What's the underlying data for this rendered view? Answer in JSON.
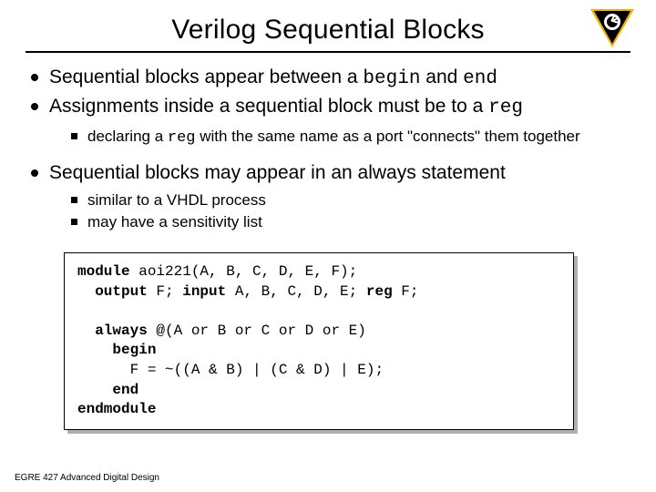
{
  "title": "Verilog Sequential Blocks",
  "footer": "EGRE 427 Advanced Digital Design",
  "bullets": {
    "b1_a": "Sequential blocks appear between a ",
    "b1_code1": "begin",
    "b1_b": " and ",
    "b1_code2": "end",
    "b2_a": "Assignments inside a sequential block must be to a ",
    "b2_code1": "reg",
    "b2s1_a": "declaring a ",
    "b2s1_code1": "reg",
    "b2s1_b": " with the same name as a port \"connects\" them together",
    "b3": "Sequential blocks may appear in an always statement",
    "b3s1": "similar to a VHDL process",
    "b3s2": "may have a sensitivity list"
  },
  "code": {
    "kw_module": "module",
    "mod_decl": " aoi221(A, B, C, D, E, F);",
    "kw_output": "output",
    "out_decl": " F; ",
    "kw_input": "input",
    "in_decl": " A, B, C, D, E; ",
    "kw_reg": "reg",
    "reg_decl": " F;",
    "kw_always": "always",
    "sens": " @(A or B or C or D or E)",
    "kw_begin": "begin",
    "assign": "      F = ~((A & B) | (C & D) | E);",
    "kw_end": "end",
    "kw_endmodule": "endmodule"
  }
}
